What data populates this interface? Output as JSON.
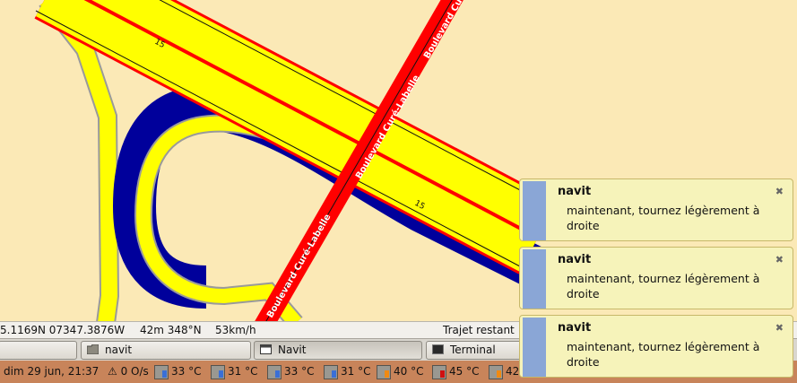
{
  "map": {
    "street_name": "Boulevard Curé-Labelle",
    "speed_label": "15",
    "colors": {
      "background": "#fbe9b6",
      "ramp": "#ffff00",
      "highway": "#ffff00",
      "route": "#00009b",
      "border": "#ff0000"
    }
  },
  "statusbar": {
    "coordinates": "5.1169N 07347.3876W",
    "distance_heading": "42m 348°N",
    "speed": "53km/h",
    "remaining_label": "Trajet restant"
  },
  "taskbar": {
    "tasks": [
      {
        "label": "",
        "icon": "blank-window-icon"
      },
      {
        "label": "navit",
        "icon": "folder-icon"
      },
      {
        "label": "Navit",
        "icon": "window-icon",
        "active": true
      },
      {
        "label": "Terminal",
        "icon": "terminal-icon"
      }
    ]
  },
  "tray": {
    "clock": "dim 29 jun, 21:37",
    "network": "0 O/s",
    "temps": [
      {
        "value": "33 °C",
        "level_color": "#3a6fd6"
      },
      {
        "value": "31 °C",
        "level_color": "#3a6fd6"
      },
      {
        "value": "33 °C",
        "level_color": "#3a6fd6"
      },
      {
        "value": "31 °C",
        "level_color": "#3a6fd6"
      },
      {
        "value": "40 °C",
        "level_color": "#f08a12"
      },
      {
        "value": "45 °C",
        "level_color": "#d01010"
      },
      {
        "value": "42",
        "level_color": "#f08a12"
      }
    ]
  },
  "notifications": [
    {
      "title": "navit",
      "body": "maintenant, tournez légèrement à droite",
      "close": "✖"
    },
    {
      "title": "navit",
      "body": "maintenant, tournez légèrement à droite",
      "close": "✖"
    },
    {
      "title": "navit",
      "body": "maintenant, tournez légèrement à droite",
      "close": "✖"
    }
  ]
}
